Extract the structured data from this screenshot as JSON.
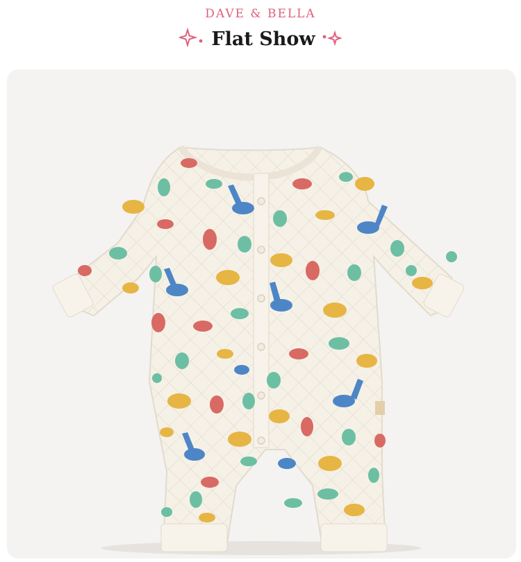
{
  "header": {
    "brand": "DAVE & BELLA",
    "title": "Flat Show"
  },
  "colors": {
    "brand_pink": "#e0607c",
    "title": "#1a1a1a",
    "backdrop": "#f4f3f2",
    "garment": "#f6f1e7",
    "dino_blue": "#4d86c6",
    "dino_red": "#d86a63",
    "dino_yellow": "#e6b543",
    "dino_green": "#6dbfa3"
  },
  "icons": [
    "sparkle-icon-left",
    "sparkle-icon-right"
  ]
}
